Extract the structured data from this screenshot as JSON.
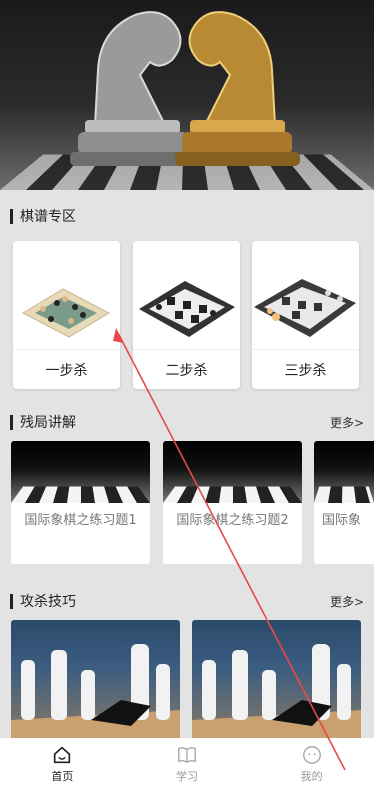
{
  "hero": {
    "alt": ""
  },
  "sections": {
    "puzzles": {
      "title": "棋谱专区"
    },
    "endgame": {
      "title": "残局讲解",
      "more": "更多>"
    },
    "technique": {
      "title": "攻杀技巧",
      "more": "更多>"
    }
  },
  "puzzles": [
    {
      "label": "一步杀"
    },
    {
      "label": "二步杀"
    },
    {
      "label": "三步杀"
    }
  ],
  "endgames": [
    {
      "title": "国际象棋之练习题1"
    },
    {
      "title": "国际象棋之练习题2"
    },
    {
      "title": "国际象"
    }
  ],
  "tabs": [
    {
      "label": "首页",
      "icon": "home-icon",
      "active": true
    },
    {
      "label": "学习",
      "icon": "book-icon",
      "active": false
    },
    {
      "label": "我的",
      "icon": "profile-icon",
      "active": false
    }
  ],
  "colors": {
    "annotation": "#e84a4a",
    "accent": "#222222"
  }
}
